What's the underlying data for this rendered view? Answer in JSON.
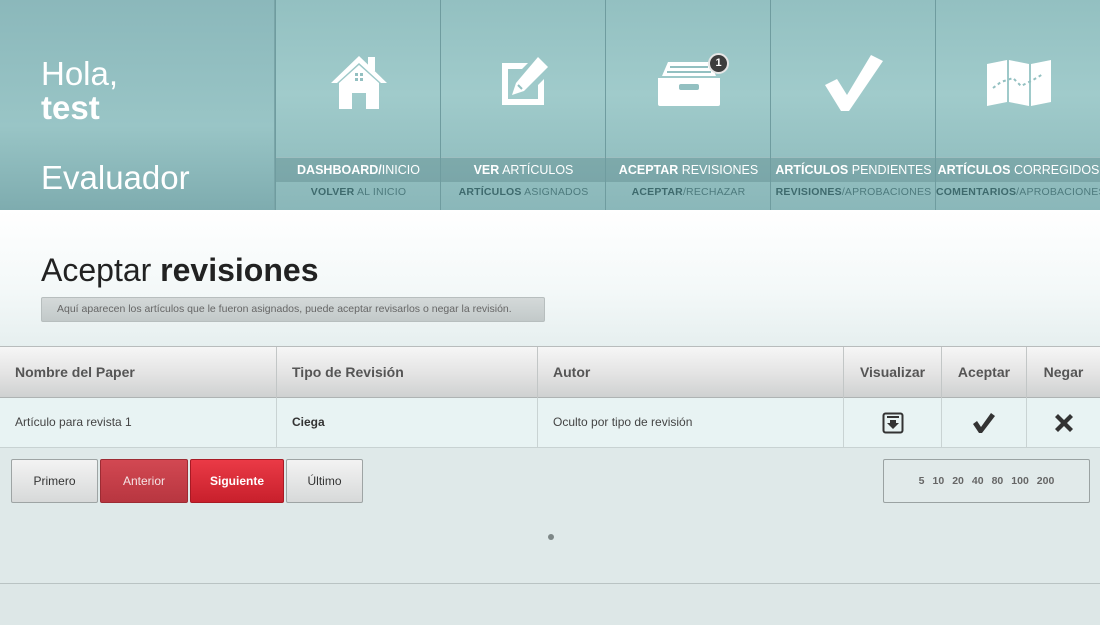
{
  "user": {
    "greeting": "Hola,",
    "name": "test",
    "role": "Evaluador"
  },
  "nav": [
    {
      "title_bold": "DASHBOARD/",
      "title_rest": "INICIO",
      "sub_bold": "VOLVER",
      "sub_rest": " AL INICIO",
      "icon": "home-icon"
    },
    {
      "title_bold": "VER",
      "title_rest": " ARTÍCULOS",
      "sub_bold": "ARTÍCULOS",
      "sub_rest": " ASIGNADOS",
      "icon": "edit-icon"
    },
    {
      "title_bold": "ACEPTAR",
      "title_rest": " REVISIONES",
      "sub_bold": "ACEPTAR",
      "sub_rest": "/RECHAZAR",
      "icon": "inbox-icon",
      "badge": "1"
    },
    {
      "title_bold": "ARTÍCULOS",
      "title_rest": " PENDIENTES",
      "sub_bold": "REVISIONES",
      "sub_rest": "/APROBACIONES",
      "icon": "checkmark-icon"
    },
    {
      "title_bold": "ARTÍCULOS",
      "title_rest": " CORREGIDOS",
      "sub_bold": "COMENTARIOS",
      "sub_rest": "/APROBACIONES",
      "icon": "map-icon"
    }
  ],
  "page": {
    "title_normal": "Aceptar ",
    "title_bold": "revisiones",
    "subtitle": "Aquí aparecen los artículos que le fueron asignados, puede aceptar revisarlos o negar la revisión."
  },
  "table": {
    "columns": [
      "Nombre del Paper",
      "Tipo de Revisión",
      "Autor",
      "Visualizar",
      "Aceptar",
      "Negar"
    ],
    "rows": [
      {
        "paper": "Artículo para revista 1",
        "tipo": "Ciega",
        "autor": "Oculto por tipo de revisión"
      }
    ]
  },
  "pagination": {
    "first": "Primero",
    "prev": "Anterior",
    "next": "Siguiente",
    "last": "Último",
    "sizes": [
      "5",
      "10",
      "20",
      "40",
      "80",
      "100",
      "200"
    ]
  },
  "colors": {
    "header_teal": "#99c5c6",
    "accent_red": "#d9303b",
    "text_dark": "#333333"
  }
}
